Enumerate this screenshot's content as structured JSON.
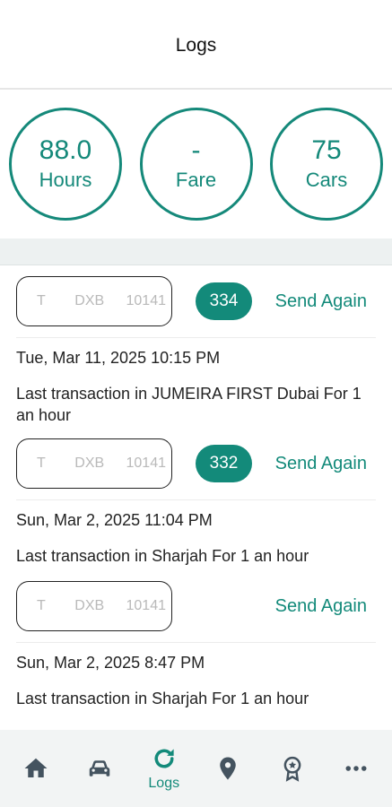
{
  "header": {
    "title": "Logs"
  },
  "stats": [
    {
      "value": "88.0",
      "label": "Hours"
    },
    {
      "value": "-",
      "label": "Fare"
    },
    {
      "value": "75",
      "label": "Cars"
    }
  ],
  "entries": [
    {
      "plate": {
        "code": "T",
        "city": "DXB",
        "number": "10141"
      },
      "badge": "334",
      "action": "Send Again",
      "date": "Tue, Mar 11, 2025 10:15 PM",
      "description": "Last transaction in JUMEIRA FIRST Dubai For 1 an hour"
    },
    {
      "plate": {
        "code": "T",
        "city": "DXB",
        "number": "10141"
      },
      "badge": "332",
      "action": "Send Again",
      "date": "Sun, Mar 2, 2025 11:04 PM",
      "description": "Last transaction in  Sharjah For 1 an hour"
    },
    {
      "plate": {
        "code": "T",
        "city": "DXB",
        "number": "10141"
      },
      "badge": "",
      "action": "Send Again",
      "date": "Sun, Mar 2, 2025 8:47 PM",
      "description": "Last transaction in  Sharjah For 1 an hour"
    }
  ],
  "nav": {
    "items": [
      {
        "icon": "home-icon",
        "label": ""
      },
      {
        "icon": "car-icon",
        "label": ""
      },
      {
        "icon": "refresh-icon",
        "label": "Logs"
      },
      {
        "icon": "location-pin-icon",
        "label": ""
      },
      {
        "icon": "award-badge-icon",
        "label": ""
      },
      {
        "icon": "more-dots-icon",
        "label": ""
      }
    ]
  },
  "colors": {
    "accent": "#138a7a",
    "navIcon": "#44535f"
  }
}
